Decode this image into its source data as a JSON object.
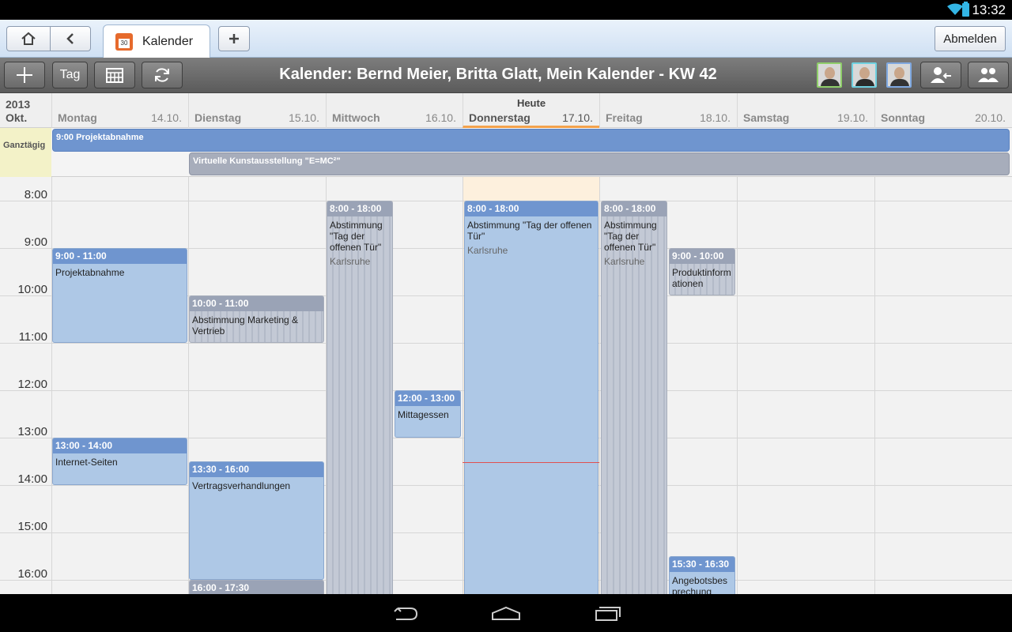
{
  "status": {
    "time": "13:32"
  },
  "tabs": {
    "active_label": "Kalender",
    "logout_label": "Abmelden"
  },
  "toolbar": {
    "day_label": "Tag",
    "title": "Kalender: Bernd Meier, Britta Glatt, Mein Kalender - KW 42"
  },
  "calendar": {
    "year": "2013",
    "month": "Okt.",
    "today_label": "Heute",
    "allday_label": "Ganztägig",
    "days": [
      {
        "name": "Montag",
        "date": "14.10."
      },
      {
        "name": "Dienstag",
        "date": "15.10."
      },
      {
        "name": "Mittwoch",
        "date": "16.10."
      },
      {
        "name": "Donnerstag",
        "date": "17.10."
      },
      {
        "name": "Freitag",
        "date": "18.10."
      },
      {
        "name": "Samstag",
        "date": "19.10."
      },
      {
        "name": "Sonntag",
        "date": "20.10."
      }
    ],
    "hours": [
      "8:00",
      "9:00",
      "10:00",
      "11:00",
      "12:00",
      "13:00",
      "14:00",
      "15:00",
      "16:00"
    ],
    "allday_events": [
      {
        "title": "9:00 Projektabnahme"
      },
      {
        "title": "Virtuelle Kunstausstellung \"E=MC²\""
      }
    ],
    "events": [
      {
        "time": "9:00 - 11:00",
        "title": "Projektabnahme",
        "location": ""
      },
      {
        "time": "13:00 - 14:00",
        "title": "Internet-Seiten",
        "location": ""
      },
      {
        "time": "10:00 - 11:00",
        "title": "Abstimmung Marketing & Vertrieb",
        "location": ""
      },
      {
        "time": "13:30 - 16:00",
        "title": "Vertragsverhandlungen",
        "location": ""
      },
      {
        "time": "16:00 - 17:30",
        "title": "",
        "location": ""
      },
      {
        "time": "8:00 - 18:00",
        "title": "Abstimmung \"Tag der offenen Tür\"",
        "location": "Karlsruhe"
      },
      {
        "time": "12:00 - 13:00",
        "title": "Mittagessen",
        "location": ""
      },
      {
        "time": "8:00 - 18:00",
        "title": "Abstimmung \"Tag der offenen Tür\"",
        "location": "Karlsruhe"
      },
      {
        "time": "8:00 - 18:00",
        "title": "Abstimmung \"Tag der offenen Tür\"",
        "location": "Karlsruhe"
      },
      {
        "time": "9:00 - 10:00",
        "title": "Produktinformationen",
        "location": ""
      },
      {
        "time": "15:30 - 16:30",
        "title": "Angebotsbesprechung",
        "location": ""
      }
    ]
  },
  "colors": {
    "event_blue": "#6f95cf",
    "event_grey": "#9aa3b6",
    "today_accent": "#f3a24c",
    "now_line": "#e05050"
  }
}
